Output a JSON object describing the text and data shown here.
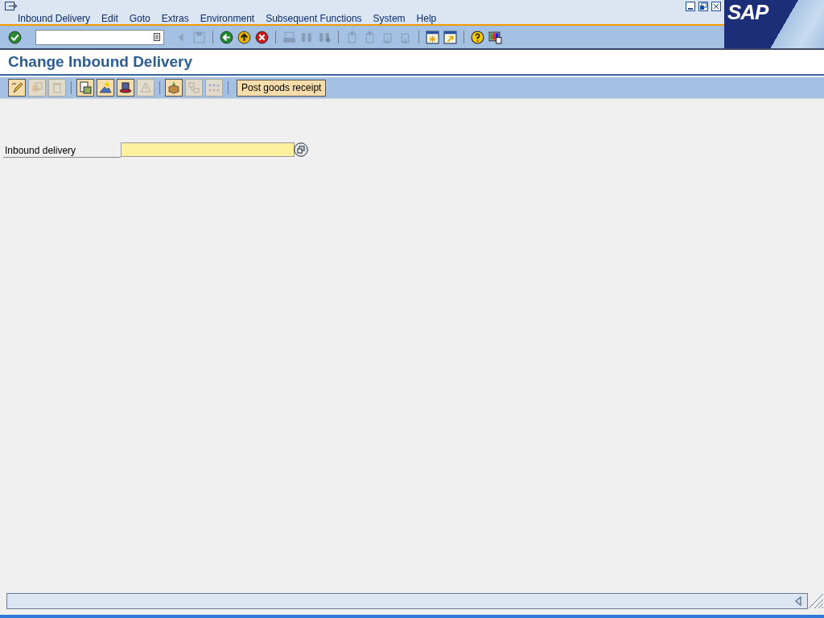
{
  "menu_bar": {
    "items": [
      "Inbound Delivery",
      "Edit",
      "Goto",
      "Extras",
      "Environment",
      "Subsequent Functions",
      "System",
      "Help"
    ]
  },
  "logo": {
    "text": "SAP"
  },
  "standard_toolbar": {
    "items": [
      {
        "kind": "enter",
        "disabled": false
      },
      {
        "kind": "command-field"
      },
      {
        "kind": "collapse",
        "disabled": true
      },
      {
        "kind": "save",
        "disabled": true
      },
      {
        "kind": "separator"
      },
      {
        "kind": "back",
        "disabled": false
      },
      {
        "kind": "exit",
        "disabled": false
      },
      {
        "kind": "cancel",
        "disabled": false
      },
      {
        "kind": "separator"
      },
      {
        "kind": "print",
        "disabled": true
      },
      {
        "kind": "find",
        "disabled": true
      },
      {
        "kind": "find-next",
        "disabled": true
      },
      {
        "kind": "separator"
      },
      {
        "kind": "first-page",
        "disabled": true
      },
      {
        "kind": "previous-page",
        "disabled": true
      },
      {
        "kind": "next-page",
        "disabled": true
      },
      {
        "kind": "last-page",
        "disabled": true
      },
      {
        "kind": "separator"
      },
      {
        "kind": "new-session",
        "disabled": false
      },
      {
        "kind": "shortcut",
        "disabled": false
      },
      {
        "kind": "separator"
      },
      {
        "kind": "help",
        "disabled": false
      },
      {
        "kind": "layout",
        "disabled": false
      }
    ]
  },
  "screen_title": "Change Inbound Delivery",
  "application_toolbar": {
    "items": [
      {
        "kind": "pencil",
        "disabled": false
      },
      {
        "kind": "copy",
        "disabled": true
      },
      {
        "kind": "trash",
        "disabled": true
      },
      {
        "kind": "separator"
      },
      {
        "kind": "document",
        "disabled": false
      },
      {
        "kind": "mountain",
        "disabled": false
      },
      {
        "kind": "hat",
        "disabled": false
      },
      {
        "kind": "warning",
        "disabled": true
      },
      {
        "kind": "separator"
      },
      {
        "kind": "box",
        "disabled": false
      },
      {
        "kind": "diagram",
        "disabled": true
      },
      {
        "kind": "dots",
        "disabled": true
      },
      {
        "kind": "separator"
      },
      {
        "kind": "button",
        "label": "Post goods receipt"
      }
    ]
  },
  "form": {
    "fields": [
      {
        "label": "Inbound delivery"
      }
    ]
  }
}
